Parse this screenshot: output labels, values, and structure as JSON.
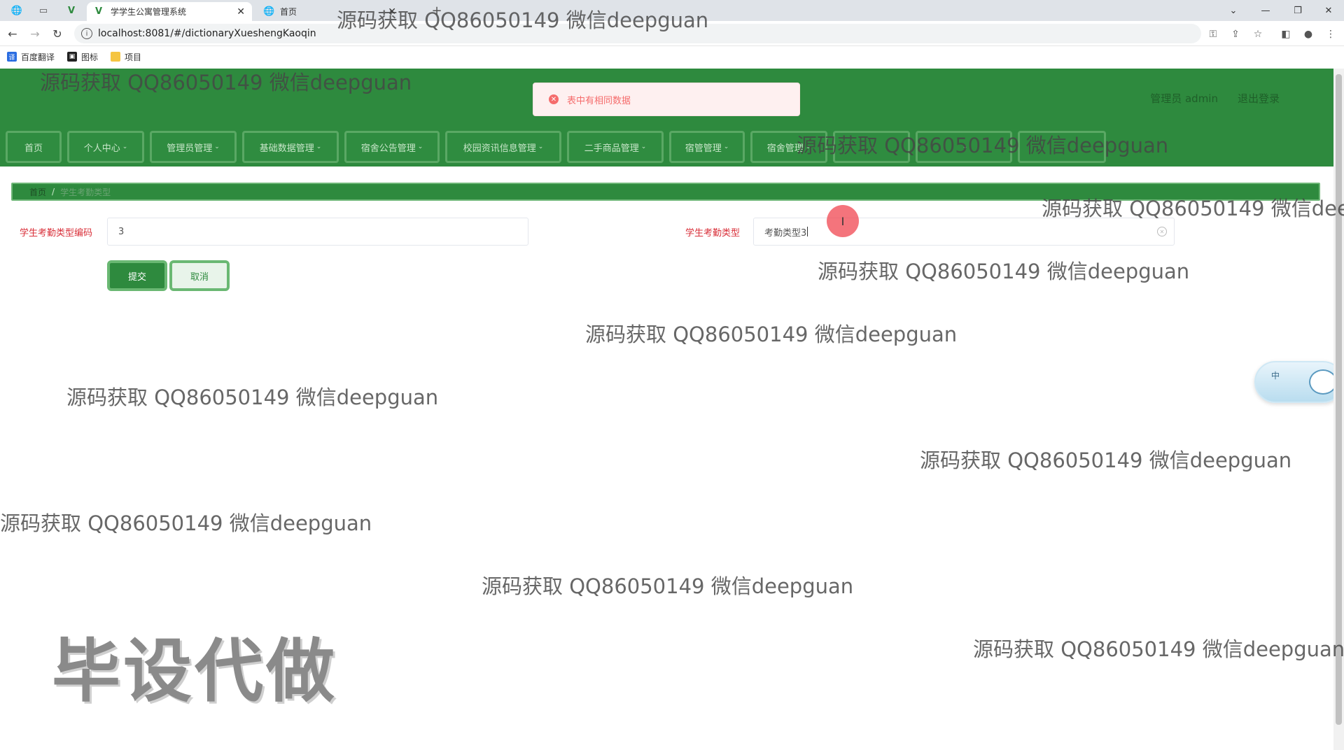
{
  "browser": {
    "tabs": [
      {
        "title": "学学生公寓管理系统",
        "active": true
      },
      {
        "title": "首页",
        "active": false
      }
    ],
    "url": "localhost:8081/#/dictionaryXueshengKaoqin",
    "bookmarks": [
      "百度翻译",
      "图标",
      "项目"
    ]
  },
  "header": {
    "user_text": "管理员 admin",
    "logout_label": "退出登录"
  },
  "toast": {
    "message": "表中有相同数据",
    "type": "error"
  },
  "menu": [
    {
      "label": "首页",
      "has_dropdown": false
    },
    {
      "label": "个人中心",
      "has_dropdown": true
    },
    {
      "label": "管理员管理",
      "has_dropdown": true
    },
    {
      "label": "基础数据管理",
      "has_dropdown": true
    },
    {
      "label": "宿舍公告管理",
      "has_dropdown": true
    },
    {
      "label": "校园资讯信息管理",
      "has_dropdown": true
    },
    {
      "label": "二手商品管理",
      "has_dropdown": true
    },
    {
      "label": "宿管管理",
      "has_dropdown": true
    },
    {
      "label": "宿舍管理",
      "has_dropdown": true
    },
    {
      "label": "",
      "has_dropdown": true
    },
    {
      "label": "",
      "has_dropdown": true
    },
    {
      "label": "",
      "has_dropdown": false
    }
  ],
  "breadcrumb": {
    "home": "首页",
    "separator": "/",
    "current": "学生考勤类型"
  },
  "form": {
    "code_label": "学生考勤类型编码",
    "code_value": "3",
    "type_label": "学生考勤类型",
    "type_value": "考勤类型3",
    "submit_label": "提交",
    "cancel_label": "取消"
  },
  "cursor": {
    "symbol": "I"
  },
  "float_widget": {
    "label": "中"
  },
  "watermarks": {
    "text": "源码获取 QQ86050149 微信deepguan",
    "stamp": "毕设代做"
  },
  "colors": {
    "primary": "#2e8a3e",
    "menu_border": "#5aa864",
    "label_red": "#d9303a",
    "toast_bg": "#fef0f0",
    "toast_text": "#f56c6c"
  }
}
